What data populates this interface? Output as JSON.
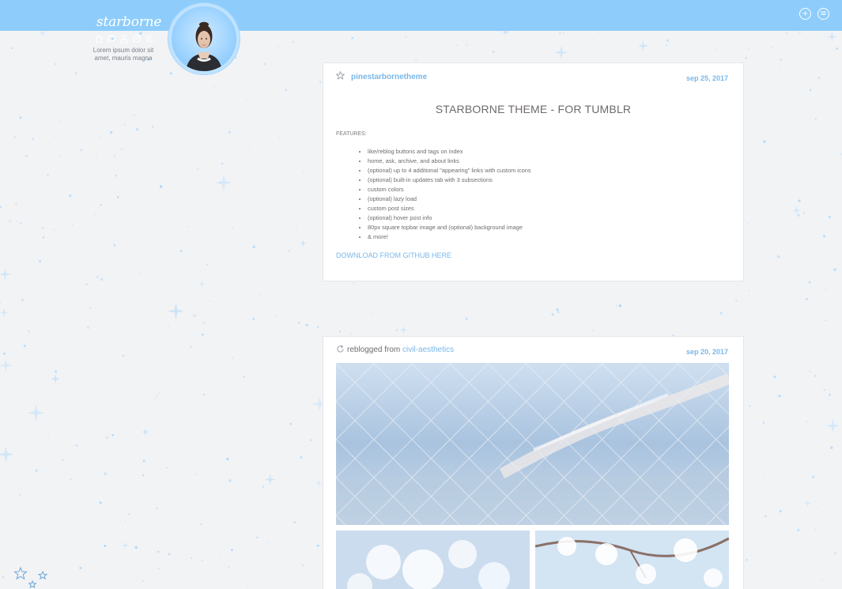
{
  "topbar": {
    "blog_title": "starborne",
    "description": "Lorem ipsum dolor sit amet, mauris magna",
    "nav_icons": [
      "home-icon",
      "ask-icon",
      "about-icon",
      "archive-icon",
      "menu-icon"
    ],
    "right_icons": [
      "plus-circle-icon",
      "list-circle-icon"
    ],
    "bar_color": "#8ecdfb",
    "accent_color": "#79b7ea"
  },
  "posts": [
    {
      "author": "pinestarbornetheme",
      "date": "sep 25, 2017",
      "title": "STARBORNE THEME - FOR TUMBLR",
      "features_label": "FEATURES:",
      "features": [
        "like/reblog buttons and tags on index",
        "home, ask, archive, and about links",
        "(optional) up to 4 additional \"appearing\" links with custom icons",
        "(optional) built-in updates tab with 3 subsections",
        "custom colors",
        "(optional) lazy load",
        "custom post sizes",
        "(optional) hover post info",
        "80px square topbar image and (optional) background image",
        "& more!"
      ],
      "link_text": "DOWNLOAD FROM GITHUB HERE"
    },
    {
      "reblog_prefix": "reblogged from",
      "reblog_source": "civil-aesthetics",
      "date": "sep 20, 2017"
    }
  ]
}
